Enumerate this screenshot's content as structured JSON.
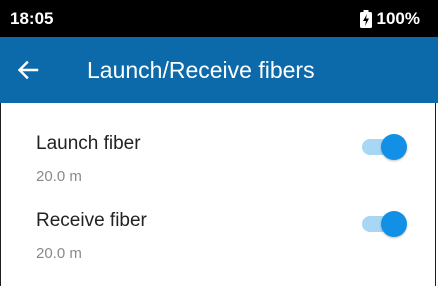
{
  "status_bar": {
    "time": "18:05",
    "battery_icon": "battery-charging-icon",
    "battery_percent": "100%"
  },
  "app_bar": {
    "back_icon": "arrow-back-icon",
    "title": "Launch/Receive fibers",
    "background_color": "#0c6aab"
  },
  "settings": [
    {
      "label": "Launch fiber",
      "value": "20.0 m",
      "enabled": true
    },
    {
      "label": "Receive fiber",
      "value": "20.0 m",
      "enabled": true
    }
  ],
  "colors": {
    "toggle_on_thumb": "#1290e6",
    "toggle_on_track": "#a8d6f5"
  }
}
